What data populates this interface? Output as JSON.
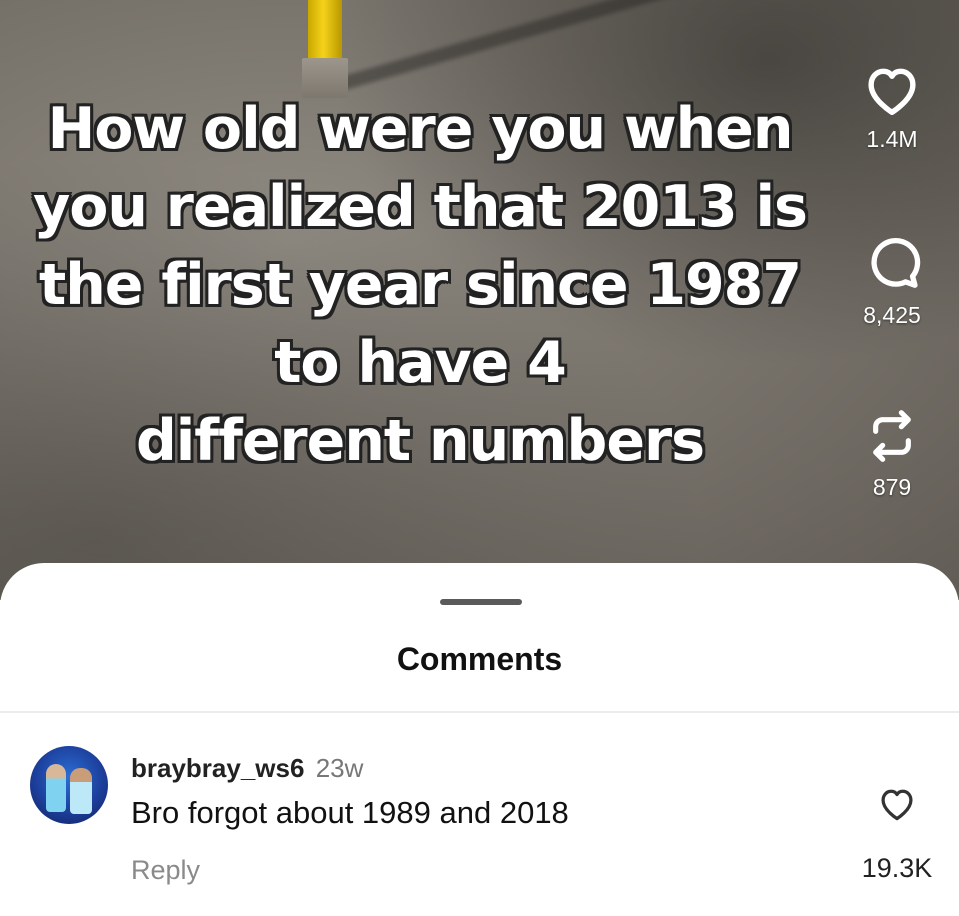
{
  "video": {
    "caption_lines": [
      "How old were you when",
      "you realized that 2013 is",
      "the first year since 1987",
      "to have 4",
      "different numbers"
    ],
    "actions": {
      "like": {
        "icon": "heart-icon",
        "count": "1.4M"
      },
      "comment": {
        "icon": "comment-bubble-icon",
        "count": "8,425"
      },
      "share": {
        "icon": "repost-icon",
        "count": "879"
      }
    }
  },
  "comments_sheet": {
    "title": "Comments",
    "comments": [
      {
        "username": "braybray_ws6",
        "time": "23w",
        "text": "Bro forgot about 1989 and 2018",
        "reply_label": "Reply",
        "likes": "19.3K",
        "like_icon": "heart-icon"
      }
    ]
  },
  "colors": {
    "sheet_background": "#ffffff",
    "caption_text": "#ffffff",
    "caption_outline": "#222222",
    "muted_text": "#8a8a8a"
  }
}
